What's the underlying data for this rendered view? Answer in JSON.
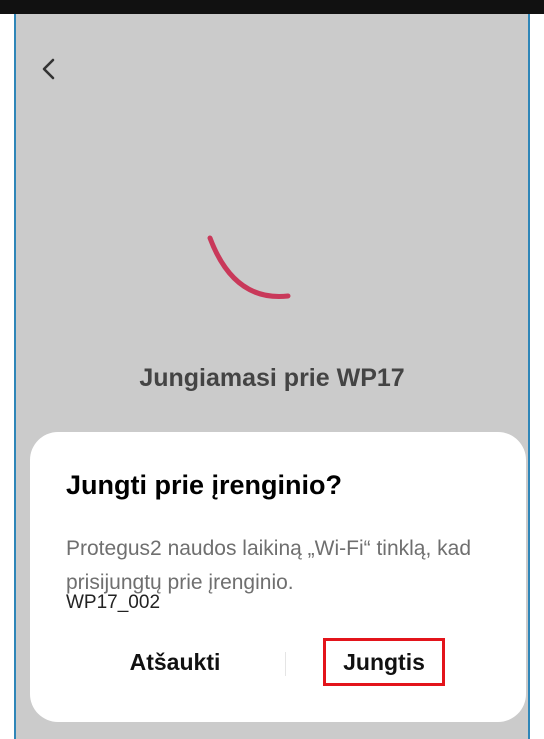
{
  "colors": {
    "screen_background": "#cbcbcb",
    "spinner": "#c9395a",
    "highlight_border": "#e3141b",
    "frame_border": "#2f86b8"
  },
  "header": {
    "back_icon": "chevron-left-icon"
  },
  "main": {
    "spinner_icon": "loading-spinner-icon",
    "connecting_text": "Jungiamasi prie WP17"
  },
  "dialog": {
    "title": "Jungti prie įrenginio?",
    "message": "Protegus2 naudos laikiną „Wi-Fi“ tinklą, kad prisijungtų prie įrenginio.",
    "device_name": "WP17_002",
    "cancel_label": "Atšaukti",
    "connect_label": "Jungtis"
  }
}
